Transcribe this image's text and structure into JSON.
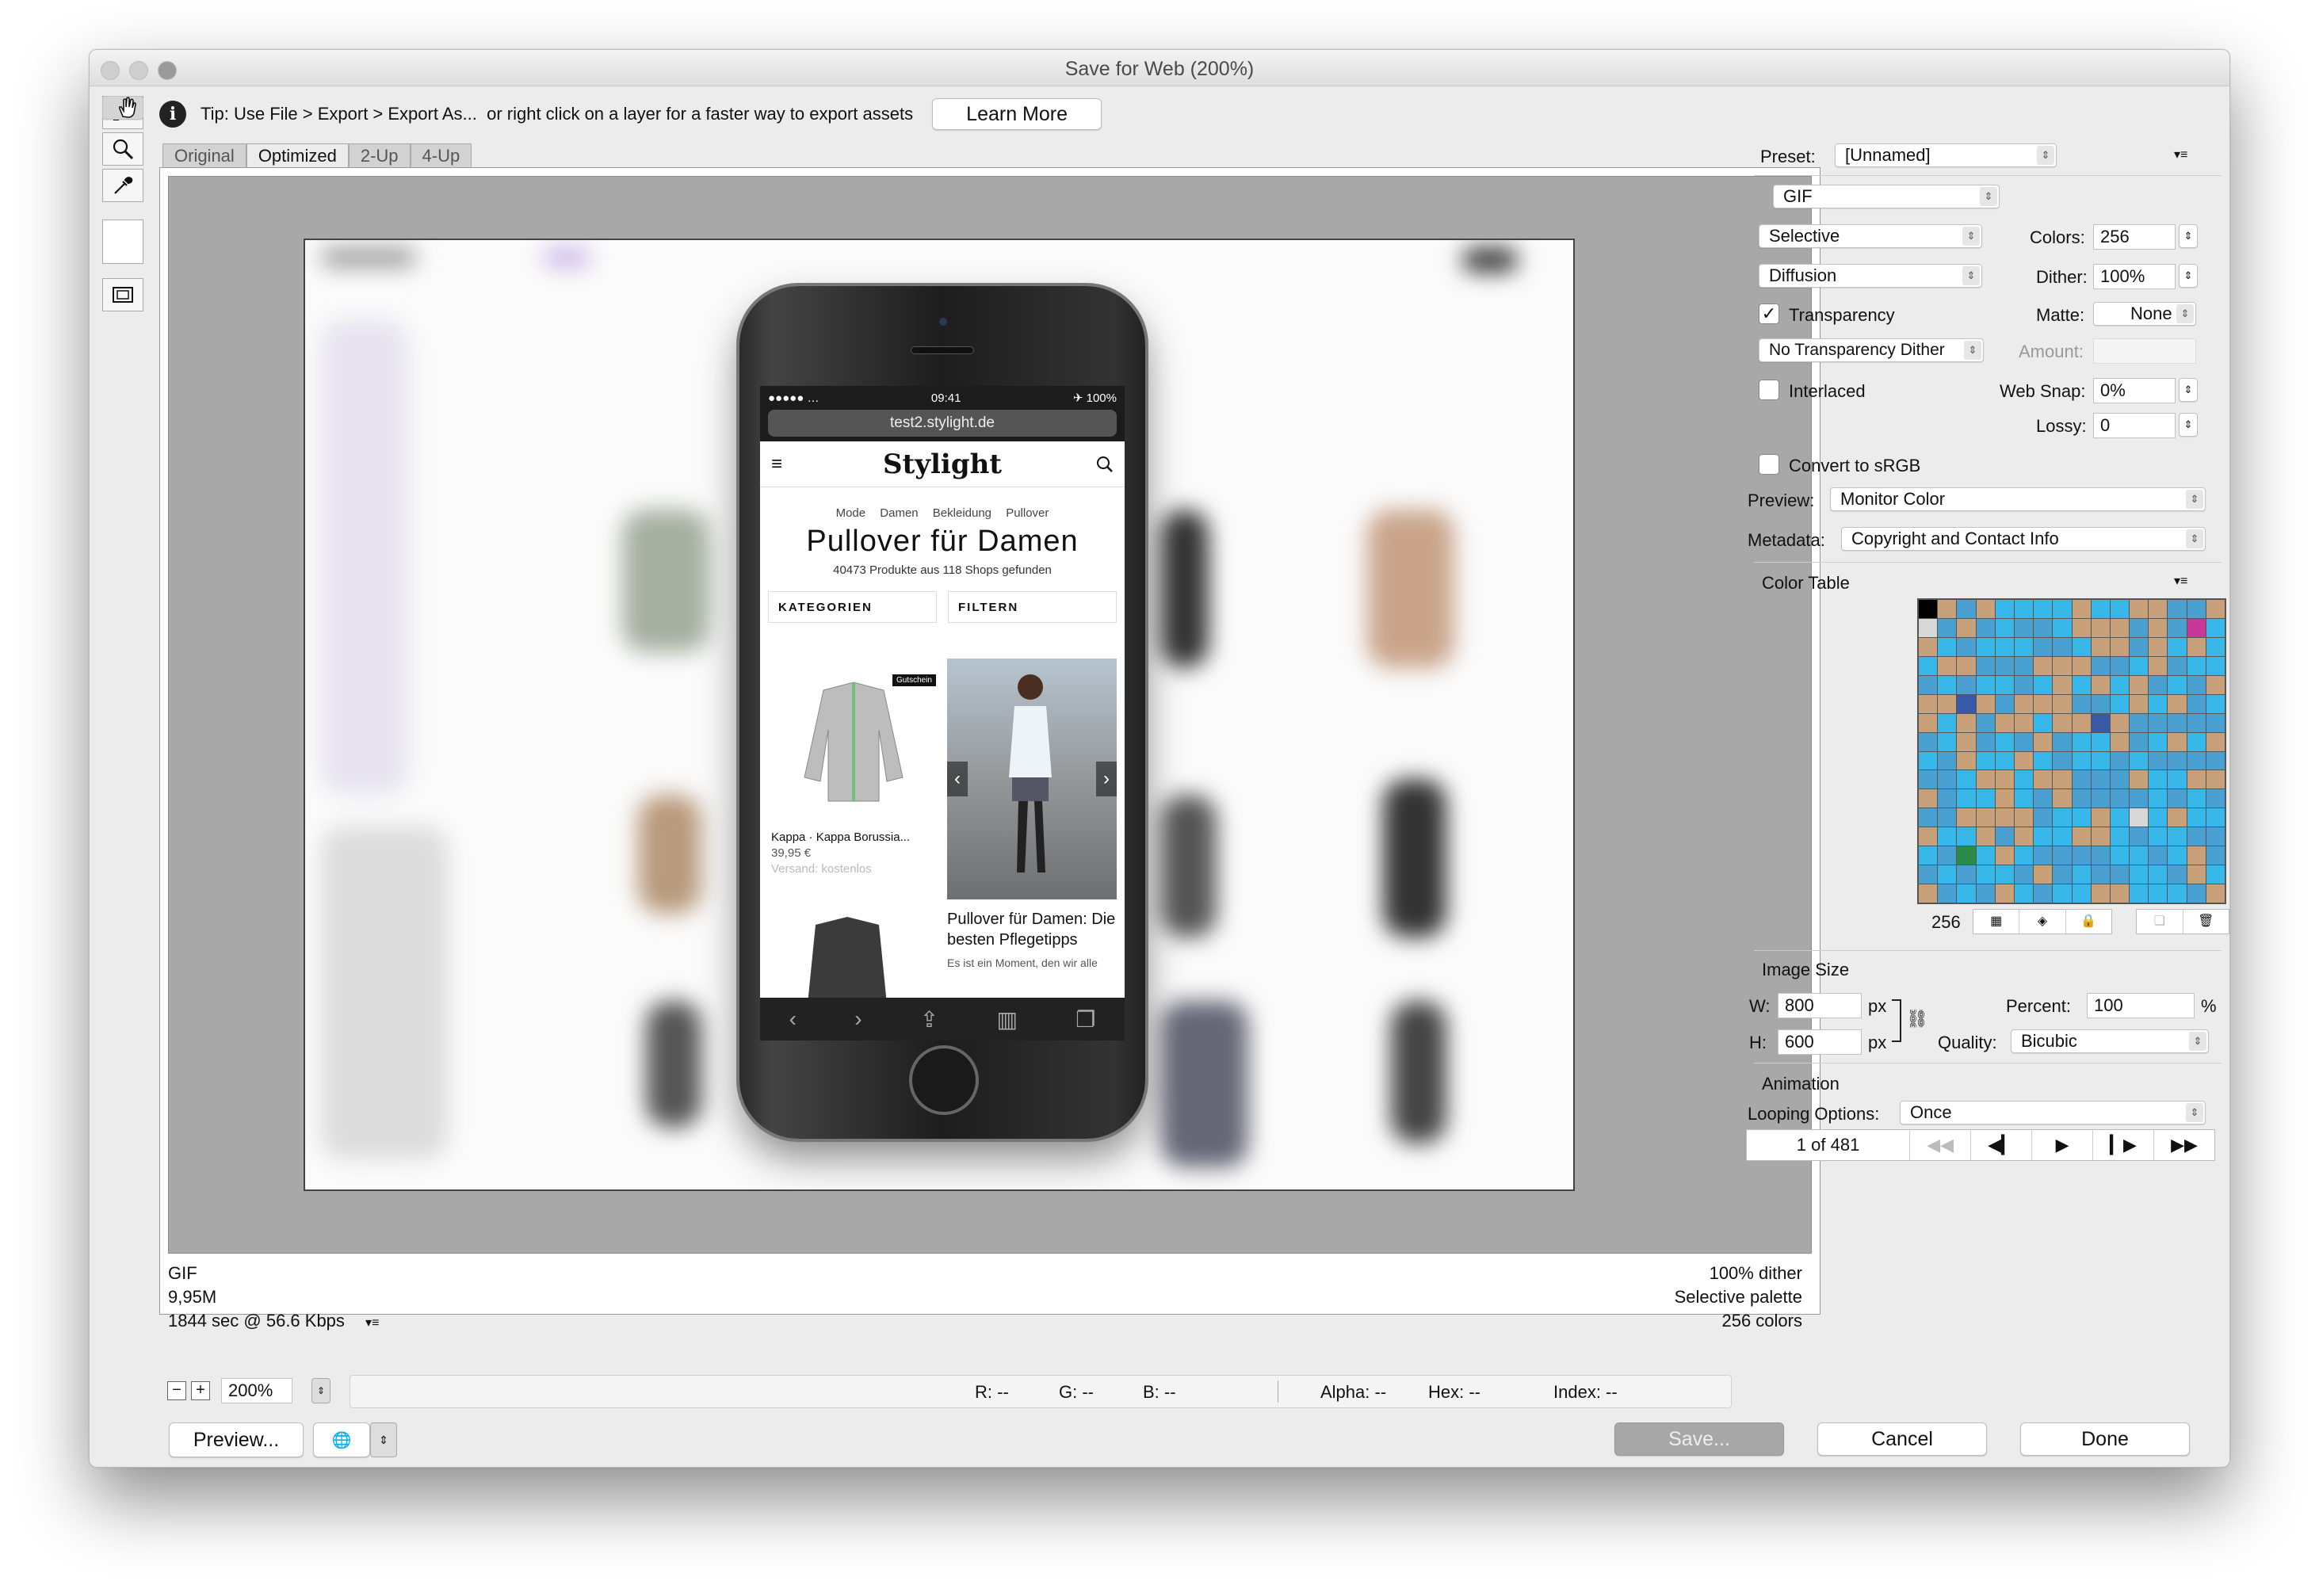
{
  "window": {
    "title": "Save for Web (200%)"
  },
  "tip": {
    "text": "Tip: Use File > Export > Export As...  or right click on a layer for a faster way to export assets",
    "learn_more": "Learn More"
  },
  "tabs": [
    "Original",
    "Optimized",
    "2-Up",
    "4-Up"
  ],
  "phone": {
    "time": "09:41",
    "carrier": "●●●●● …",
    "battery": "✈ 100%",
    "url": "test2.stylight.de",
    "logo": "Stylight",
    "menu": "≡",
    "breadcrumb": "Mode Damen Bekleidung Pullover",
    "title": "Pullover für Damen",
    "subtitle": "40473 Produkte aus 118 Shops gefunden",
    "filter1": "KATEGORIEN",
    "filter2": "FILTERN",
    "product_name": "Kappa · Kappa Borussia...",
    "product_price": "39,95 €",
    "product_shipping": "Versand: kostenlos",
    "badge": "Gutschein",
    "article_title": "Pullover für Damen: Die besten Pflegetipps",
    "article_snippet": "Es ist ein Moment, den wir alle"
  },
  "info_left": [
    "GIF",
    "9,95M",
    "1844 sec @ 56.6 Kbps"
  ],
  "info_right": [
    "100% dither",
    "Selective palette",
    "256 colors"
  ],
  "settings": {
    "preset_label": "Preset:",
    "preset": "[Unnamed]",
    "format": "GIF",
    "reduction": "Selective",
    "dither_algo": "Diffusion",
    "colors_label": "Colors:",
    "colors": "256",
    "dither_label": "Dither:",
    "dither": "100%",
    "transparency": "Transparency",
    "matte_label": "Matte:",
    "matte": "None",
    "trans_dither": "No Transparency Dither",
    "amount_label": "Amount:",
    "interlaced": "Interlaced",
    "websnap_label": "Web Snap:",
    "websnap": "0%",
    "lossy_label": "Lossy:",
    "lossy": "0",
    "convert": "Convert to sRGB",
    "preview_label": "Preview:",
    "preview": "Monitor Color",
    "metadata_label": "Metadata:",
    "metadata": "Copyright and Contact Info"
  },
  "color_table": {
    "title": "Color Table",
    "count": "256"
  },
  "image_size": {
    "title": "Image Size",
    "w_label": "W:",
    "w": "800",
    "h_label": "H:",
    "h": "600",
    "px": "px",
    "percent_label": "Percent:",
    "percent": "100",
    "pct": "%",
    "quality_label": "Quality:",
    "quality": "Bicubic"
  },
  "animation": {
    "title": "Animation",
    "looping_label": "Looping Options:",
    "looping": "Once",
    "frame": "1 of 481"
  },
  "bottom": {
    "zoom": "200%",
    "r": "R: --",
    "g": "G: --",
    "b": "B: --",
    "alpha": "Alpha: --",
    "hex": "Hex: --",
    "index": "Index: --",
    "preview": "Preview...",
    "save": "Save...",
    "cancel": "Cancel",
    "done": "Done"
  }
}
